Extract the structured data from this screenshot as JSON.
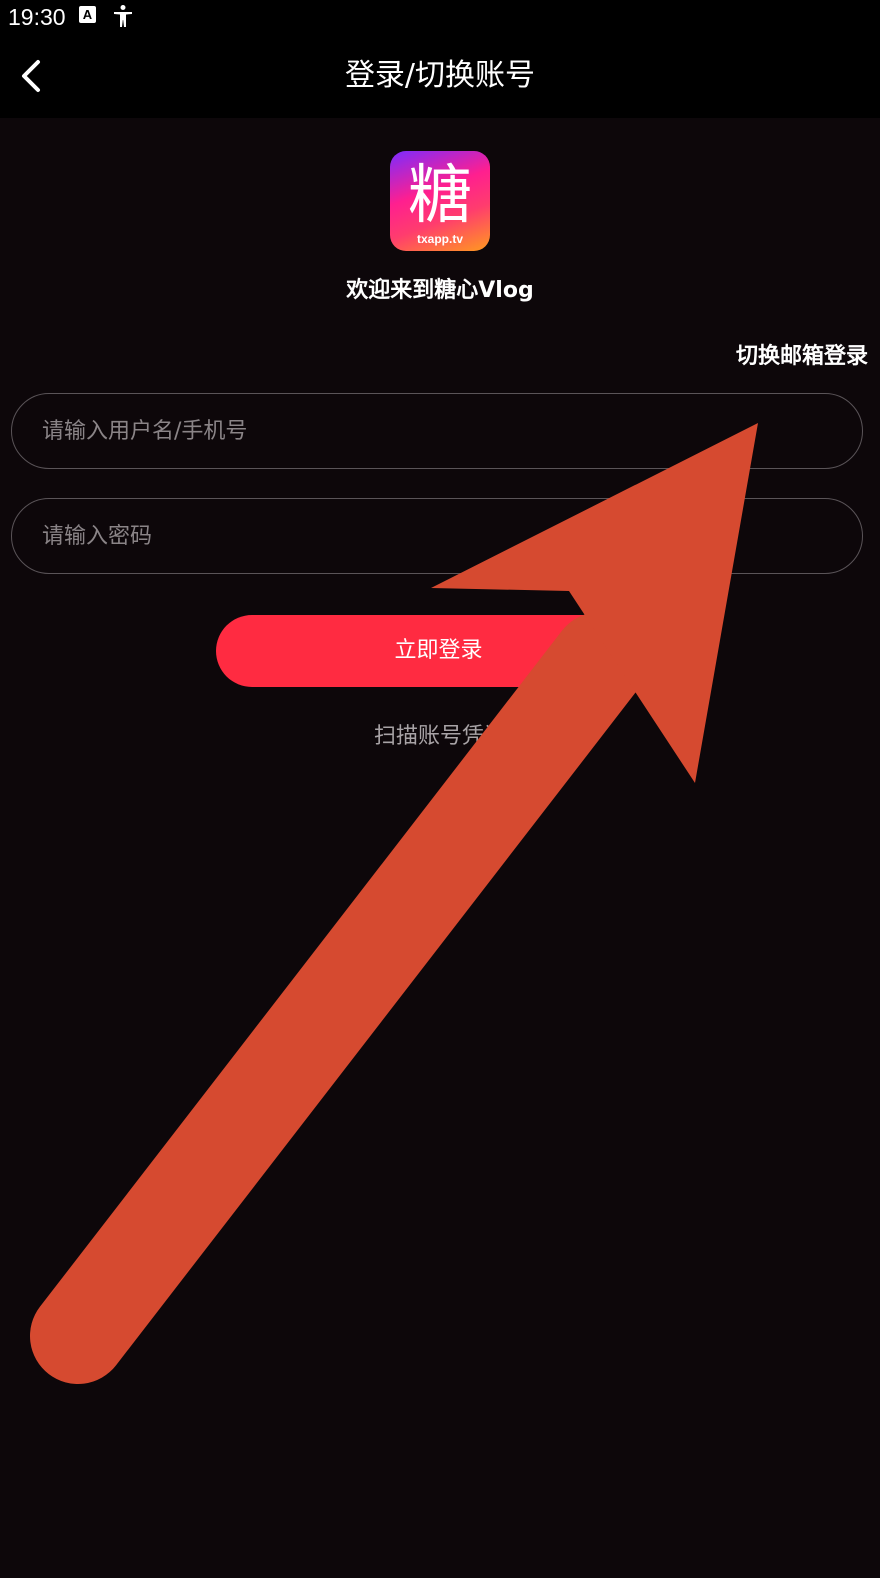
{
  "status_bar": {
    "time": "19:30",
    "icons": [
      "text-a-icon",
      "accessibility-icon"
    ]
  },
  "header": {
    "title": "登录/切换账号",
    "back_icon": "chevron-left-icon"
  },
  "logo": {
    "icon": "app-logo-icon",
    "domain_text": "txapp.tv",
    "logo_glyph": "糖"
  },
  "welcome_text": "欢迎来到糖心Vlog",
  "switch_email_label": "切换邮箱登录",
  "form": {
    "username_placeholder": "请输入用户名/手机号",
    "username_value": "",
    "password_placeholder": "请输入密码",
    "password_value": ""
  },
  "login_button_label": "立即登录",
  "scan_link_label": "扫描账号凭证",
  "colors": {
    "background": "#0d070a",
    "accent": "#ff2b41",
    "annotation": "#d64a30"
  }
}
